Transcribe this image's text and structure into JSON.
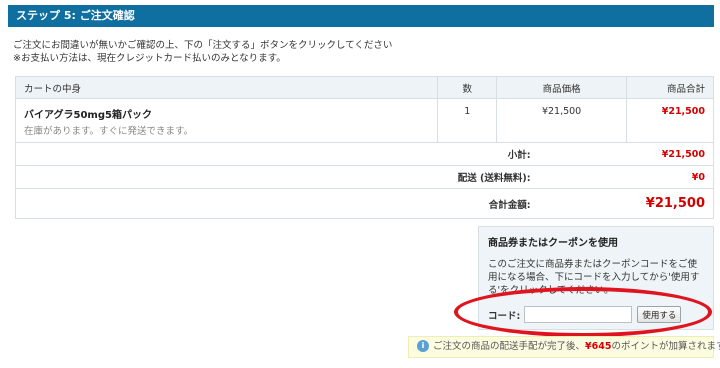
{
  "step_header": "ステップ 5: ご注文確認",
  "instructions": {
    "line1": "ご注文にお間違いが無いかご確認の上、下の「注文する」ボタンをクリックしてください",
    "line2": "※お支払い方法は、現在クレジットカード払いのみとなります。"
  },
  "cart": {
    "headers": {
      "item": "カートの中身",
      "qty": "数",
      "price": "商品価格",
      "total": "商品合計"
    },
    "items": [
      {
        "name": "バイアグラ50mg5箱パック",
        "stock": "在庫があります。すぐに発送できます。",
        "qty": "1",
        "price": "¥21,500",
        "total": "¥21,500"
      }
    ],
    "subtotal_label": "小計:",
    "subtotal_value": "¥21,500",
    "shipping_label": "配送 (送料無料):",
    "shipping_value": "¥0",
    "grand_label": "合計金額:",
    "grand_value": "¥21,500"
  },
  "coupon": {
    "title": "商品券またはクーポンを使用",
    "description": "このご注文に商品券またはクーポンコードをご使用になる場合、下にコードを入力してから'使用する'をクリックしてください。",
    "code_label": "コード:",
    "code_value": "",
    "apply_button": "使用する"
  },
  "points_note": {
    "icon": "info-icon",
    "icon_glyph": "i",
    "prefix": "ご注文の商品の配送手配が完了後、",
    "points": "¥645",
    "suffix": "のポイントが加算されます。"
  },
  "colors": {
    "header_bg": "#0f6fa0",
    "price_red": "#d40000",
    "highlight_ellipse": "#e0141e",
    "coupon_bg": "#eef4f7",
    "note_bg": "#fcfce0"
  }
}
